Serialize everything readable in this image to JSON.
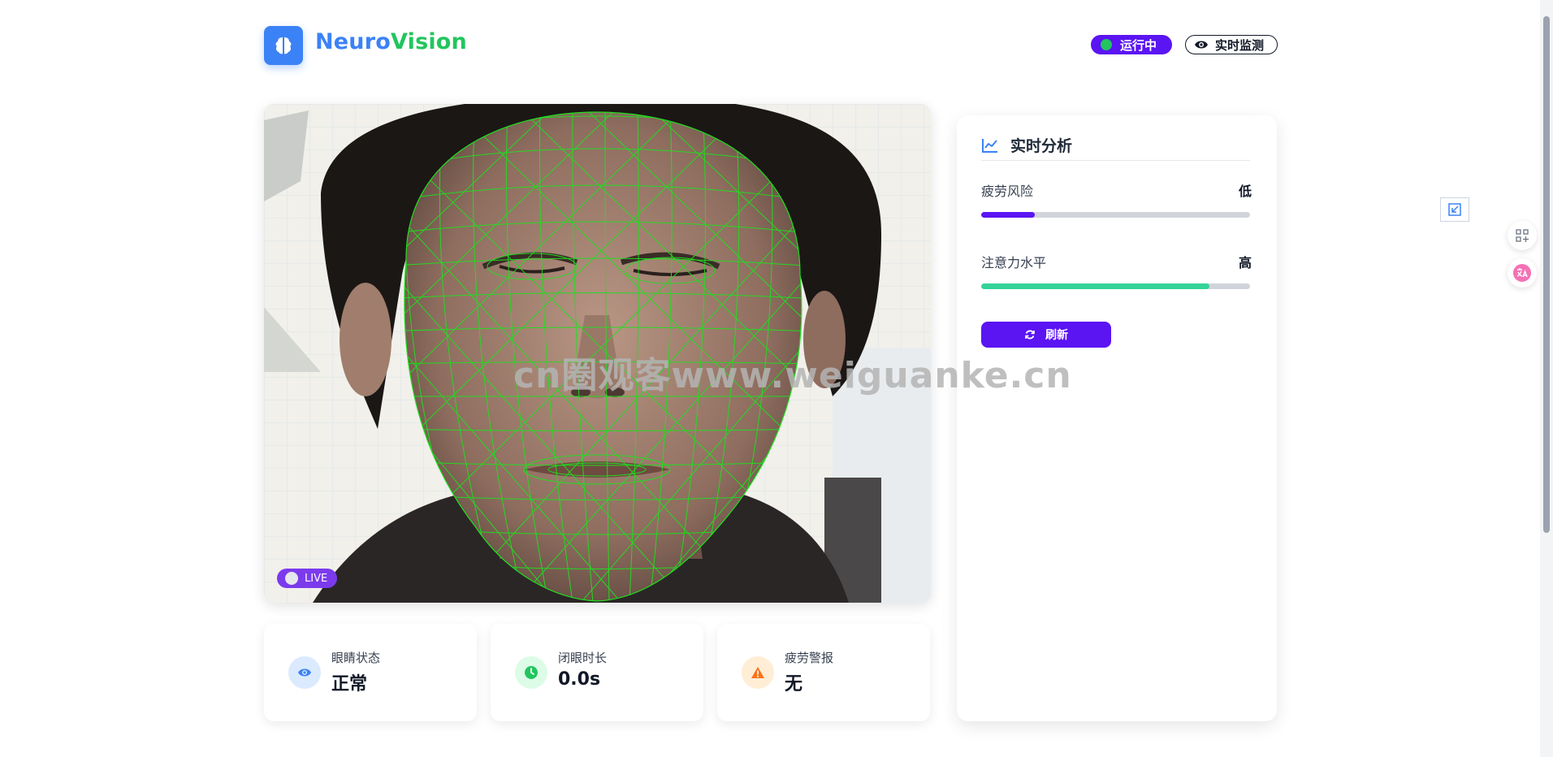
{
  "header": {
    "brand_part1": "Neuro",
    "brand_part2": "Vision",
    "logo_icon": "brain-icon",
    "status_running": "运行中",
    "status_monitor": "实时监测"
  },
  "video": {
    "live_label": "LIVE",
    "overlay": "face-mesh"
  },
  "stats": [
    {
      "label": "眼睛状态",
      "value": "正常",
      "icon": "eye-icon",
      "color": "#3b82f6"
    },
    {
      "label": "闭眼时长",
      "value": "0.0s",
      "icon": "clock-icon",
      "color": "#22c55e"
    },
    {
      "label": "疲劳警报",
      "value": "无",
      "icon": "warning-icon",
      "color": "#f97316"
    }
  ],
  "panel": {
    "title": "实时分析",
    "title_icon": "line-chart-icon",
    "metrics": [
      {
        "label": "疲劳风险",
        "value": "低",
        "level": 0.2,
        "color": "#5b14f2"
      },
      {
        "label": "注意力水平",
        "value": "高",
        "level": 0.85,
        "color": "#34d399"
      }
    ],
    "refresh_label": "刷新"
  },
  "watermark": "cn圈观客www.weiguanke.cn",
  "colors": {
    "accent": "#5b14f2",
    "brand_blue": "#3b82f6",
    "brand_green": "#22c55e"
  }
}
